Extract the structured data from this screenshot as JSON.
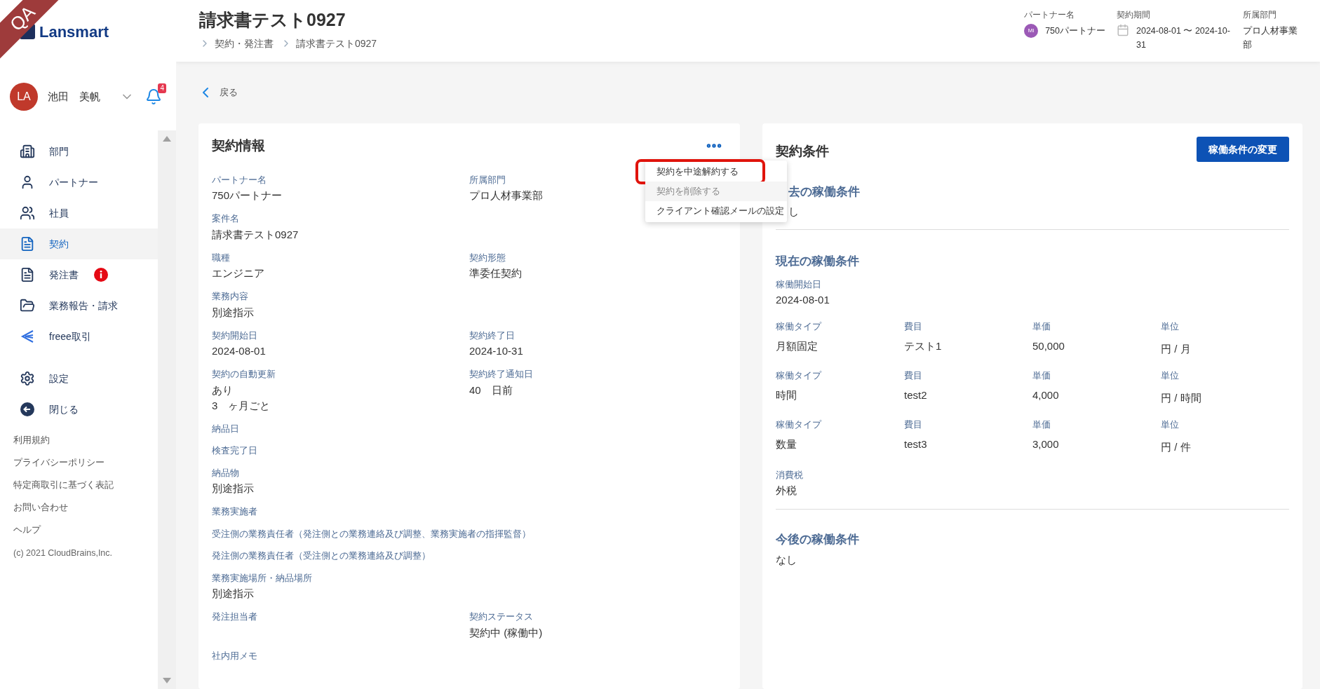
{
  "env_badge": "QA",
  "logo": "Lansmart",
  "user": {
    "initials": "LA",
    "name": "池田　美帆",
    "notifications": "4"
  },
  "sidebar": {
    "items": [
      {
        "label": "部門",
        "selected": false,
        "alert": false
      },
      {
        "label": "パートナー",
        "selected": false,
        "alert": false
      },
      {
        "label": "社員",
        "selected": false,
        "alert": false
      },
      {
        "label": "契約",
        "selected": true,
        "alert": false
      },
      {
        "label": "発注書",
        "selected": false,
        "alert": true
      },
      {
        "label": "業務報告・請求",
        "selected": false,
        "alert": false
      },
      {
        "label": "freee取引",
        "selected": false,
        "alert": false
      }
    ],
    "bottom_items": [
      {
        "label": "設定",
        "selected": false
      },
      {
        "label": "閉じる",
        "selected": false
      }
    ],
    "links": [
      "利用規約",
      "プライバシーポリシー",
      "特定商取引に基づく表記",
      "お問い合わせ",
      "ヘルプ"
    ],
    "copyright": "(c) 2021 CloudBrains,Inc."
  },
  "header": {
    "title": "請求書テスト0927",
    "breadcrumb": [
      "契約・発注書",
      "請求書テスト0927"
    ],
    "meta": [
      {
        "kind": "avatar",
        "label": "パートナー名",
        "badge": "MI",
        "value": "750パートナー"
      },
      {
        "kind": "calendar",
        "label": "契約期間",
        "value": "2024-08-01 〜 2024-10-31"
      },
      {
        "kind": "plain",
        "label": "所属部門",
        "value": "プロ人材事業部"
      }
    ]
  },
  "back_link": "戻る",
  "contract_info": {
    "title": "契約情報",
    "menu": [
      {
        "label": "契約を中途解約する",
        "disabled": false,
        "highlighted": true
      },
      {
        "label": "契約を削除する",
        "disabled": true,
        "highlighted": false
      },
      {
        "label": "クライアント確認メールの設定",
        "disabled": false,
        "highlighted": false
      }
    ],
    "rows": [
      [
        {
          "label": "パートナー名",
          "lines": [
            "750パートナー"
          ]
        },
        {
          "label": "所属部門",
          "lines": [
            "プロ人材事業部"
          ]
        }
      ],
      [
        {
          "label": "案件名",
          "lines": [
            "請求書テスト0927"
          ]
        }
      ],
      [
        {
          "label": "職種",
          "lines": [
            "エンジニア"
          ]
        },
        {
          "label": "契約形態",
          "lines": [
            "準委任契約"
          ]
        }
      ],
      [
        {
          "label": "業務内容",
          "lines": [
            "別途指示"
          ]
        }
      ],
      [
        {
          "label": "契約開始日",
          "lines": [
            "2024-08-01"
          ]
        },
        {
          "label": "契約終了日",
          "lines": [
            "2024-10-31"
          ]
        }
      ],
      [
        {
          "label": "契約の自動更新",
          "lines": [
            "あり",
            "3　ヶ月ごと"
          ]
        },
        {
          "label": "契約終了通知日",
          "lines": [
            "40　日前"
          ]
        }
      ],
      [
        {
          "label": "納品日"
        }
      ],
      [
        {
          "label": "検査完了日"
        }
      ],
      [
        {
          "label": "納品物",
          "lines": [
            "別途指示"
          ]
        }
      ],
      [
        {
          "label": "業務実施者"
        }
      ],
      [
        {
          "label": "受注側の業務責任者（発注側との業務連絡及び調整、業務実施者の指揮監督）"
        }
      ],
      [
        {
          "label": "発注側の業務責任者（受注側との業務連絡及び調整）"
        }
      ],
      [
        {
          "label": "業務実施場所・納品場所",
          "lines": [
            "別途指示"
          ]
        }
      ],
      [
        {
          "label": "発注担当者"
        },
        {
          "label": "契約ステータス",
          "lines": [
            "契約中 (稼働中)"
          ]
        }
      ],
      [
        {
          "label": "社内用メモ"
        }
      ]
    ]
  },
  "conditions": {
    "title": "契約条件",
    "button": "稼働条件の変更",
    "past": {
      "heading": "去の稼働条件",
      "value": "し"
    },
    "current": {
      "heading": "現在の稼働条件",
      "start_label": "稼働開始日",
      "start": "2024-08-01",
      "rows": [
        [
          {
            "label": "稼働タイプ",
            "value": "月額固定"
          },
          {
            "label": "費目",
            "value": "テスト1"
          },
          {
            "label": "単価",
            "value": "50,000"
          },
          {
            "label": "単位",
            "value": "円 / 月"
          }
        ],
        [
          {
            "label": "稼働タイプ",
            "value": "時間"
          },
          {
            "label": "費目",
            "value": "test2"
          },
          {
            "label": "単価",
            "value": "4,000"
          },
          {
            "label": "単位",
            "value": "円 / 時間"
          }
        ],
        [
          {
            "label": "稼働タイプ",
            "value": "数量"
          },
          {
            "label": "費目",
            "value": "test3"
          },
          {
            "label": "単価",
            "value": "3,000"
          },
          {
            "label": "単位",
            "value": "円 / 件"
          }
        ]
      ],
      "tax_label": "消費税",
      "tax": "外税"
    },
    "future": {
      "heading": "今後の稼働条件",
      "value": "なし"
    }
  }
}
